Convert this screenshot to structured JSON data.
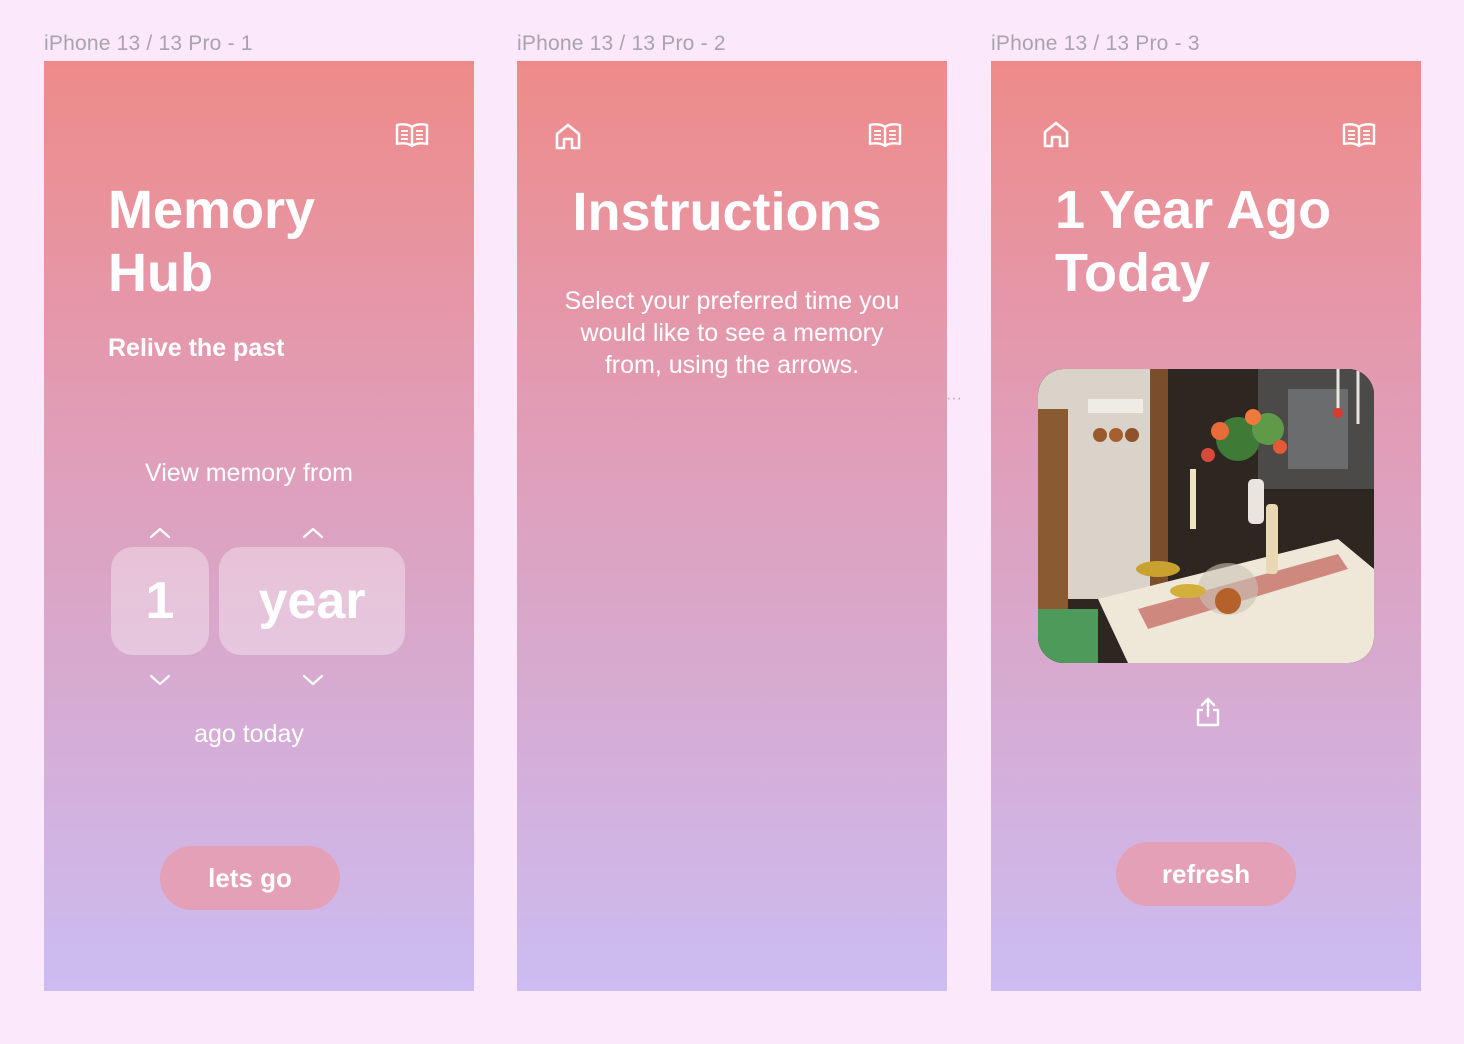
{
  "frames": [
    {
      "label": "iPhone 13 / 13 Pro - 1",
      "title_line1": "Memory",
      "title_line2": "Hub",
      "subtitle": "Relive the past",
      "view_from_label": "View memory from",
      "number_value": "1",
      "unit_value": "year",
      "ago_label": "ago today",
      "button_label": "lets go",
      "icons": [
        "book-icon",
        "chevron-up-icon",
        "chevron-down-icon"
      ]
    },
    {
      "label": "iPhone 13 / 13 Pro - 2",
      "title": "Instructions",
      "body": "Select your preferred time you would like to see a memory from, using the arrows.",
      "icons": [
        "home-icon",
        "book-icon"
      ]
    },
    {
      "label": "iPhone 13 / 13 Pro - 3",
      "title_line1": "1 Year Ago",
      "title_line2": "Today",
      "button_label": "refresh",
      "icons": [
        "home-icon",
        "book-icon",
        "share-icon"
      ]
    }
  ],
  "colors": {
    "canvas": "#fbe8fb",
    "gradient_top": "#ee8b89",
    "gradient_bottom": "#ccbcf2",
    "button": "#e3a0b6",
    "text": "#ffffff"
  }
}
